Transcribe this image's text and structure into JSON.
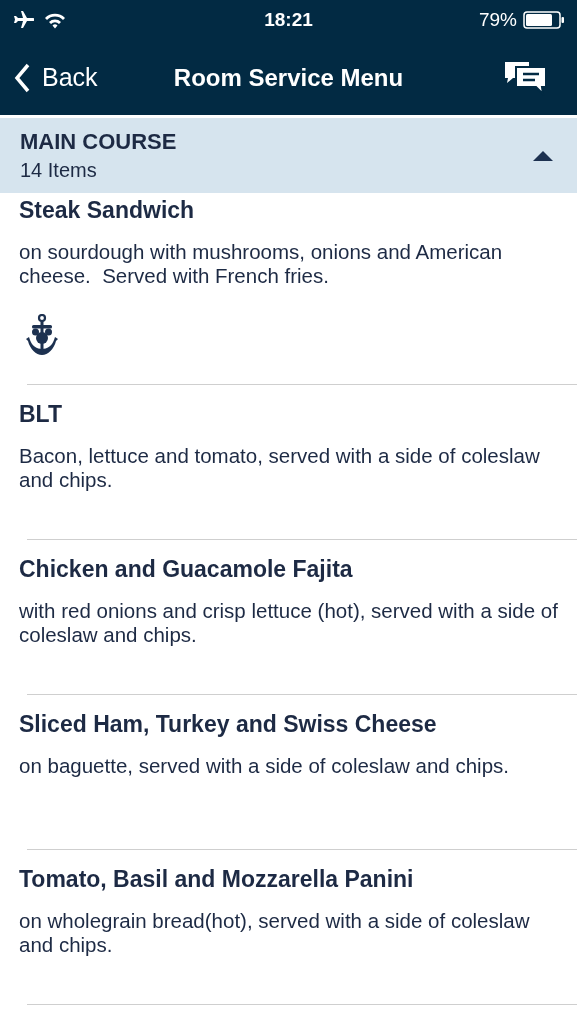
{
  "status_bar": {
    "time": "18:21",
    "battery": "79%"
  },
  "nav": {
    "back": "Back",
    "title": "Room Service Menu"
  },
  "section": {
    "title": "MAIN COURSE",
    "count": "14 Items",
    "expanded": true
  },
  "items": [
    {
      "name": "Steak Sandwich",
      "description": "on sourdough with mushrooms, onions and American cheese.  Served with French fries.",
      "kind": "featured"
    },
    {
      "name": "BLT",
      "description": "Bacon, lettuce and tomato, served with a side of coleslaw and chips.",
      "kind": "plain"
    },
    {
      "name": "Chicken and Guacamole Fajita",
      "description": "with red onions and crisp lettuce (hot), served with a side of coleslaw and chips.",
      "kind": "plain"
    },
    {
      "name": "Sliced Ham, Turkey and Swiss Cheese",
      "description": "on baguette, served with a side of coleslaw and chips.",
      "kind": "plain"
    },
    {
      "name": "Tomato, Basil and Mozzarella Panini",
      "description": "on wholegrain bread(hot), served with a side of coleslaw and chips.",
      "kind": "plain"
    }
  ]
}
